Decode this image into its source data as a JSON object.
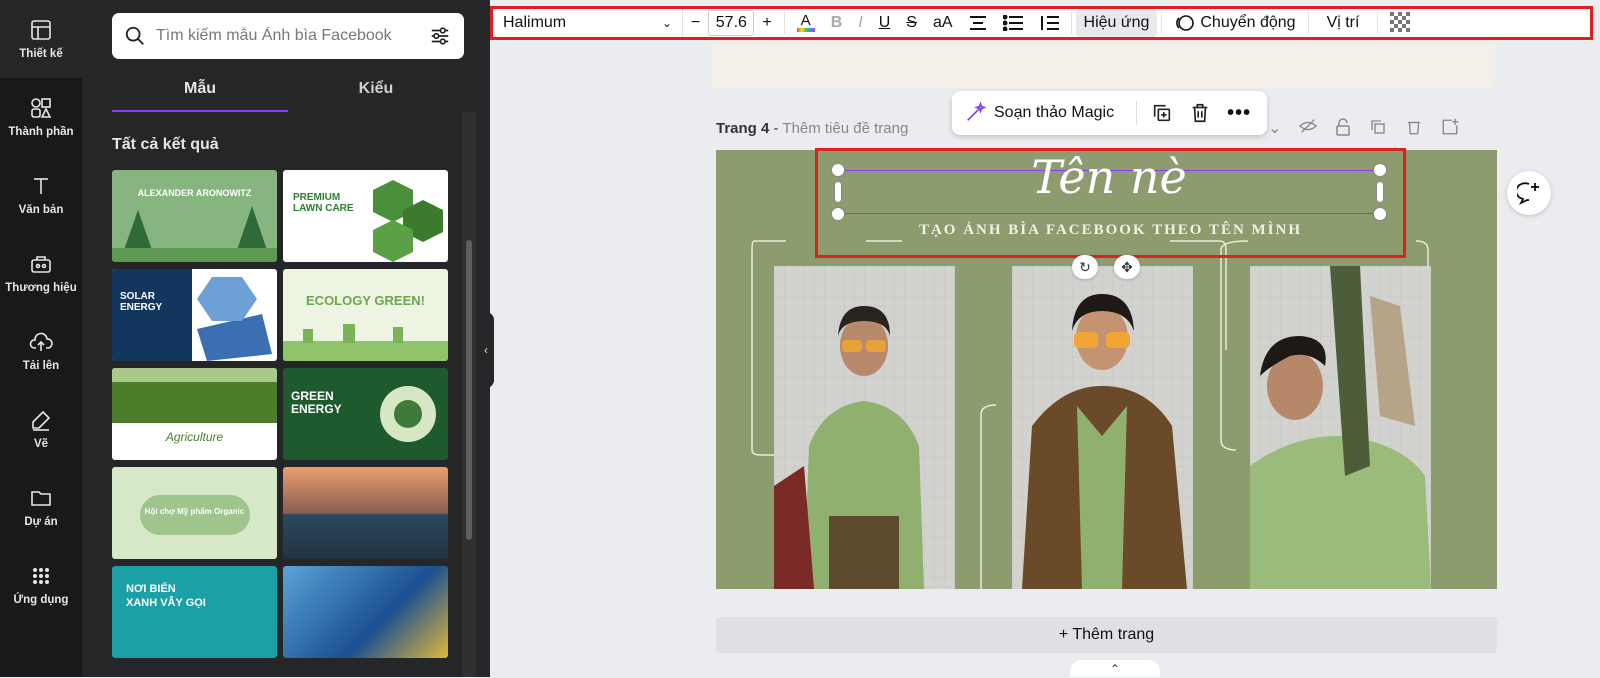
{
  "rail": [
    {
      "label": "Thiết kế",
      "icon": "template-icon"
    },
    {
      "label": "Thành phần",
      "icon": "elements-icon"
    },
    {
      "label": "Văn bản",
      "icon": "text-icon"
    },
    {
      "label": "Thương hiệu",
      "icon": "brand-icon"
    },
    {
      "label": "Tải lên",
      "icon": "upload-icon"
    },
    {
      "label": "Vẽ",
      "icon": "draw-icon"
    },
    {
      "label": "Dự án",
      "icon": "folder-icon"
    },
    {
      "label": "Ứng dụng",
      "icon": "apps-icon"
    }
  ],
  "panel": {
    "search_placeholder": "Tìm kiếm mẫu Ảnh bìa Facebook",
    "tabs": [
      "Mẫu",
      "Kiểu"
    ],
    "section_title": "Tất cả kết quả",
    "thumbs": [
      {
        "text": "ALEXANDER ARONOWITZ",
        "bg": "#7fb07a"
      },
      {
        "text": "PREMIUM LAWN CARE",
        "bg": "#ffffff"
      },
      {
        "text": "SOLAR ENERGY",
        "bg": "#ffffff"
      },
      {
        "text": "ECOLOGY GREEN!",
        "bg": "#eef4e2"
      },
      {
        "text": "Agriculture",
        "bg": "#ffffff"
      },
      {
        "text": "GREEN ENERGY",
        "bg": "#1f5a2e"
      },
      {
        "text": "Hội chợ Mỹ phẩm Organic",
        "bg": "#d7e8c9"
      },
      {
        "text": "",
        "bg": "#e47a4a"
      },
      {
        "text": "NƠI BIỂN XANH VẪY GỌI",
        "bg": "#1a9a9e"
      },
      {
        "text": "",
        "bg": "#2a62a5"
      }
    ]
  },
  "toolbar": {
    "font": "Halimum",
    "size": "57.6",
    "effects": "Hiệu ứng",
    "animate": "Chuyển động",
    "position": "Vị trí"
  },
  "canvas": {
    "page_label": "Trang 4",
    "page_title_placeholder": "Thêm tiêu đề trang",
    "magic": "Soạn thảo Magic",
    "title": "Tên nè",
    "subtitle": "TẠO ẢNH BÌA FACEBOOK THEO TÊN MÌNH",
    "add_page": "+ Thêm trang"
  }
}
